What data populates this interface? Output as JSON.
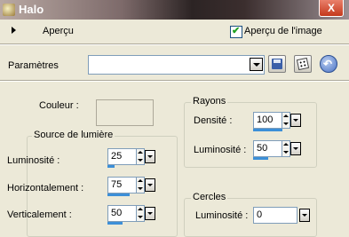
{
  "window": {
    "title": "Halo",
    "close_label": "X"
  },
  "preview": {
    "label": "Aperçu",
    "image_preview_label": "Aperçu de l'image",
    "image_preview_checked": true
  },
  "params": {
    "label": "Paramètres",
    "preset_value": ""
  },
  "couleur": {
    "label": "Couleur :",
    "color": "#ece9d8"
  },
  "source": {
    "title": "Source de lumière",
    "luminosite": {
      "label": "Luminosité :",
      "value": "25",
      "level": 0.25
    },
    "horizontal": {
      "label": "Horizontalement :",
      "value": "75",
      "level": 0.75
    },
    "vertical": {
      "label": "Verticalement :",
      "value": "50",
      "level": 0.5
    }
  },
  "rayons": {
    "title": "Rayons",
    "densite": {
      "label": "Densité :",
      "value": "100",
      "level": 1.0
    },
    "luminosite": {
      "label": "Luminosité :",
      "value": "50",
      "level": 0.5
    }
  },
  "cercles": {
    "title": "Cercles",
    "luminosite": {
      "label": "Luminosité :",
      "value": "0",
      "level": 0.0
    }
  },
  "colors": {
    "accent": "#3c8fd8"
  }
}
